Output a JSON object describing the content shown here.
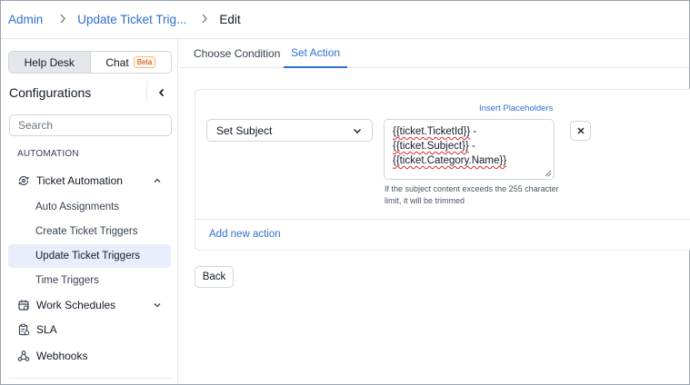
{
  "breadcrumb": {
    "root": "Admin",
    "parent": "Update Ticket Trig...",
    "current": "Edit",
    "separator": ">"
  },
  "sidebar": {
    "segments": [
      {
        "label": "Help Desk",
        "active": true
      },
      {
        "label": "Chat",
        "badge": "Beta",
        "active": false
      }
    ],
    "title": "Configurations",
    "search_placeholder": "Search",
    "section_label": "AUTOMATION",
    "groups": [
      {
        "label": "Ticket Automation",
        "icon": "ticket-automation-icon",
        "expanded": true
      },
      {
        "label": "Work Schedules",
        "icon": "calendar-icon",
        "expanded": false
      },
      {
        "label": "SLA",
        "icon": "sla-clipboard-icon"
      },
      {
        "label": "Webhooks",
        "icon": "webhook-icon"
      }
    ],
    "ticket_automation_items": [
      {
        "label": "Auto Assignments",
        "active": false
      },
      {
        "label": "Create Ticket Triggers",
        "active": false
      },
      {
        "label": "Update Ticket Triggers",
        "active": true
      },
      {
        "label": "Time Triggers",
        "active": false
      }
    ]
  },
  "tabs": [
    {
      "label": "Choose Condition",
      "active": false
    },
    {
      "label": "Set Action",
      "active": true
    }
  ],
  "action": {
    "field_select_value": "Set Subject",
    "insert_placeholders_label": "Insert Placeholders",
    "value_line1_token": "{{ticket.TicketId}}",
    "value_line1_suffix": " -",
    "value_line2_token": "{{ticket.Subject}}",
    "value_line2_suffix": " -",
    "value_line3_token": "{{ticket.Category.Name}}",
    "hint": "If the subject content exceeds the 255 character limit, it will be trimmed",
    "add_new_action_label": "Add new action"
  },
  "footer": {
    "back_label": "Back"
  },
  "colors": {
    "accent": "#2f6fd1",
    "active_nav_bg": "#e8eefb",
    "beta_badge": "#c2410c"
  }
}
